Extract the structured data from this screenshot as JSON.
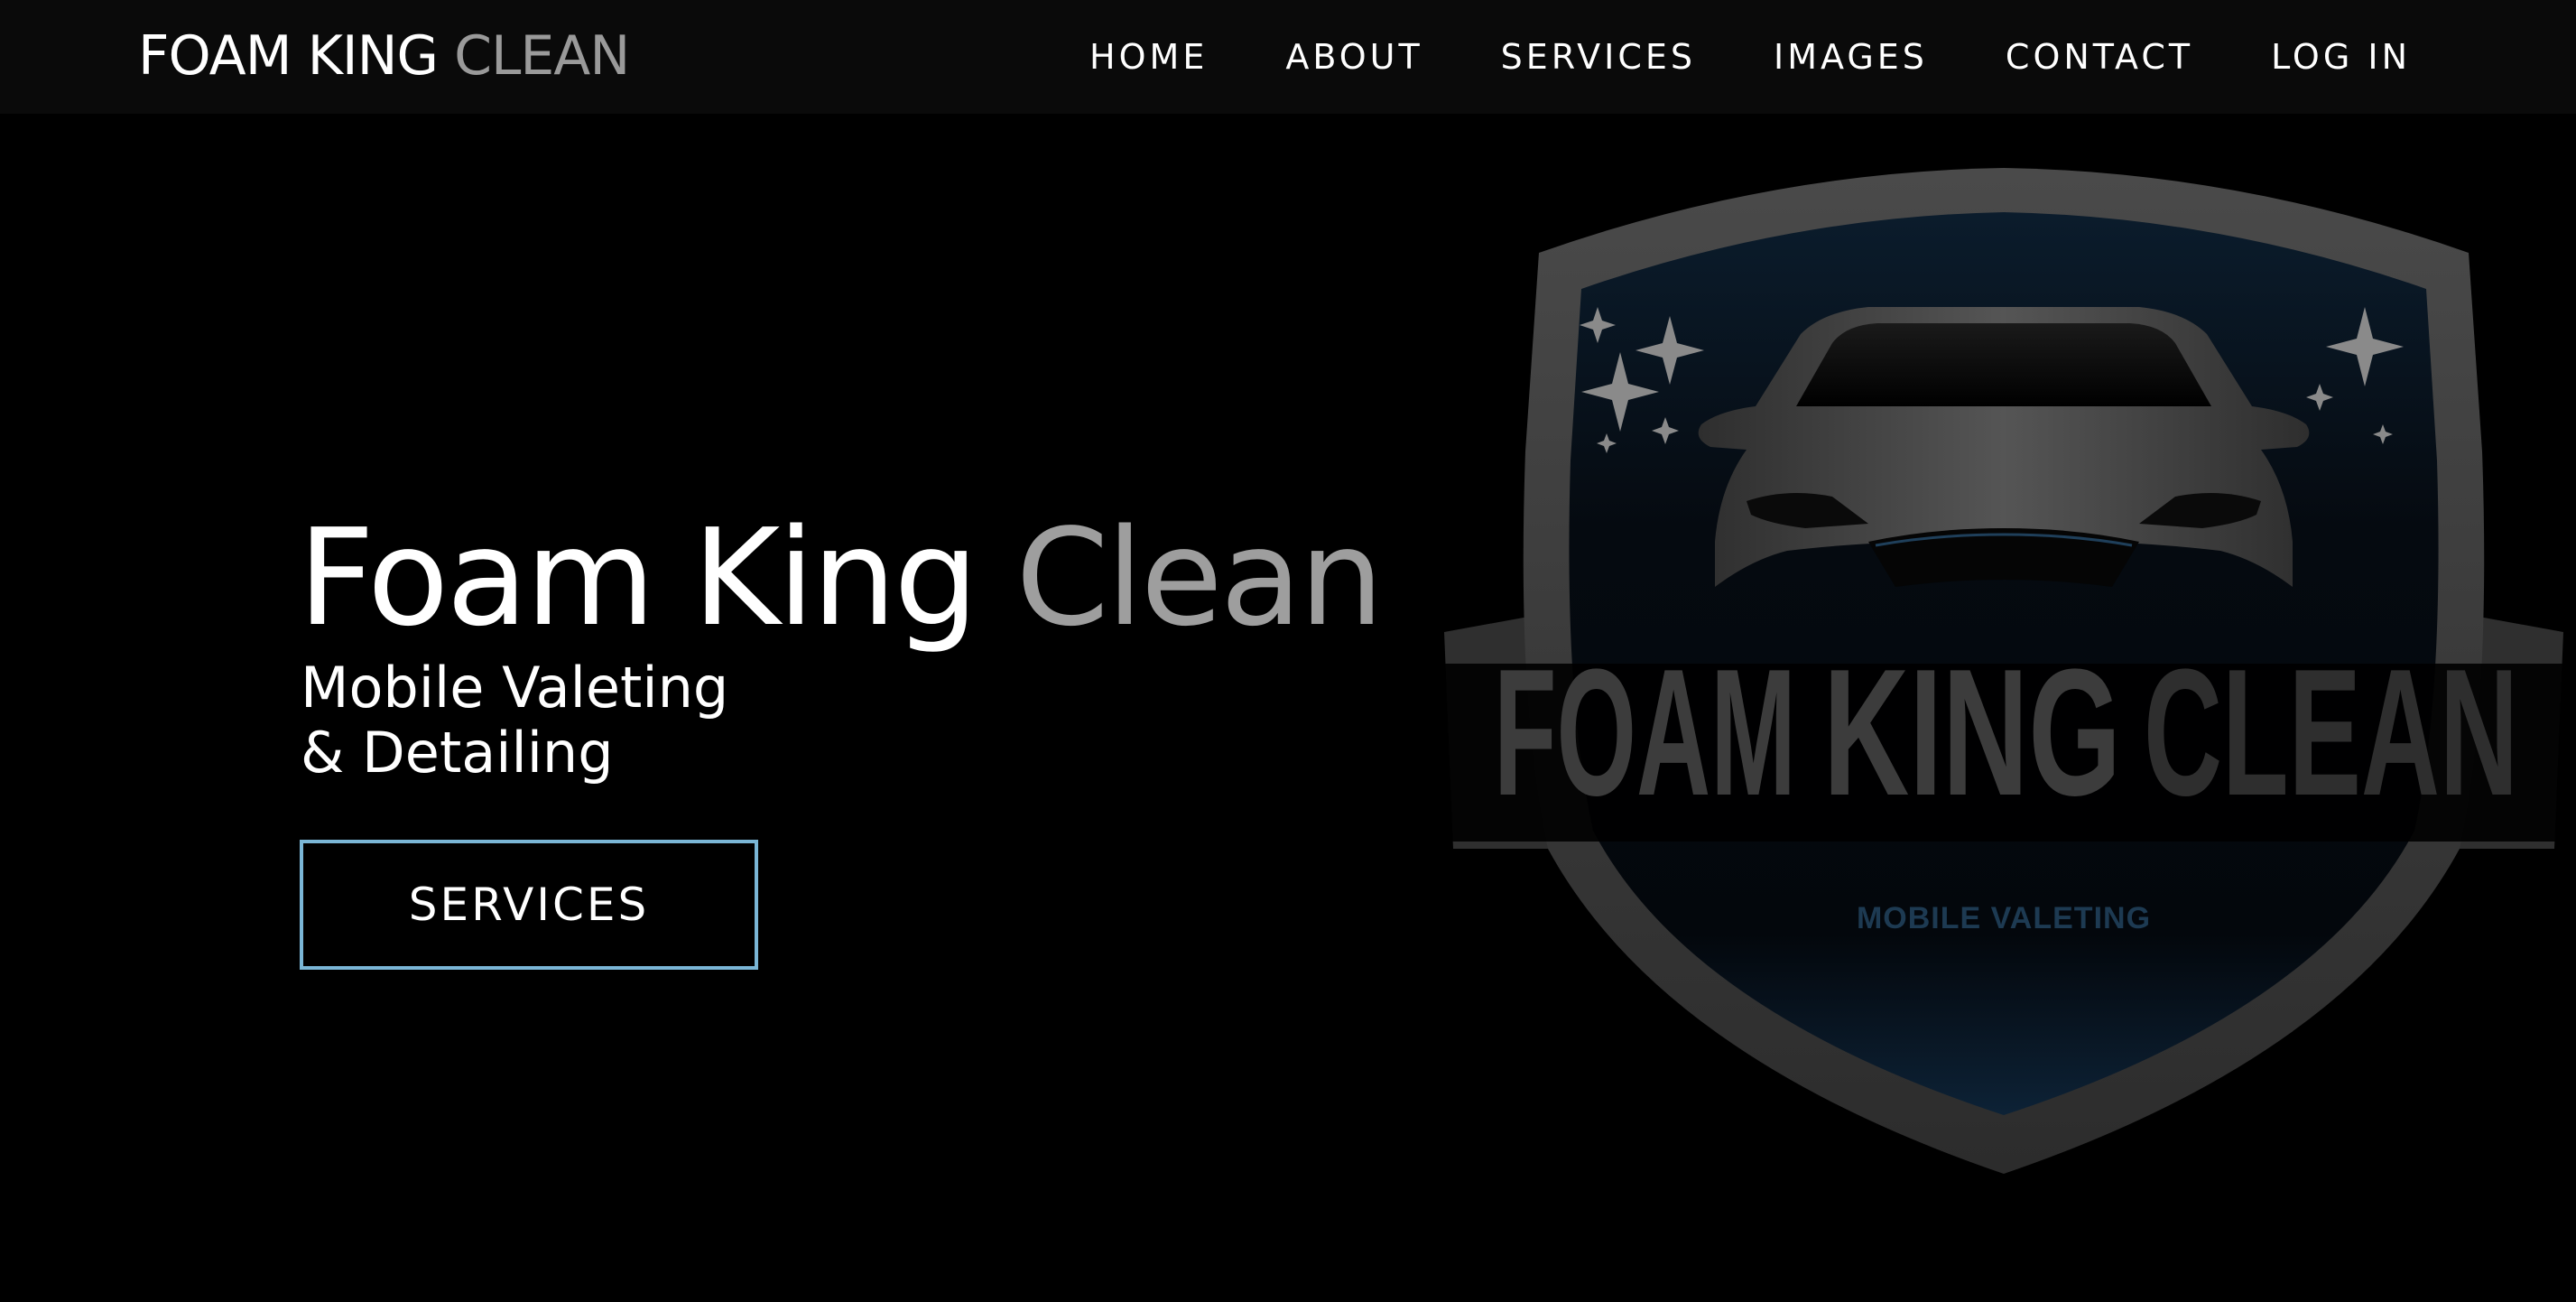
{
  "brand": {
    "part1": "FOAM KING",
    "part2": "CLEAN"
  },
  "nav": {
    "items": [
      {
        "label": "HOME"
      },
      {
        "label": "ABOUT"
      },
      {
        "label": "SERVICES"
      },
      {
        "label": "IMAGES"
      },
      {
        "label": "CONTACT"
      },
      {
        "label": "LOG IN"
      }
    ]
  },
  "hero": {
    "title_part1": "Foam King",
    "title_part2": "Clean",
    "subtitle_line1": "Mobile Valeting",
    "subtitle_line2": "& Detailing",
    "button_label": "SERVICES"
  },
  "logo": {
    "word1": "FOAM",
    "word2": "KING",
    "word3": "CLEAN",
    "tagline": "MOBILE VALETING"
  },
  "colors": {
    "background": "#000000",
    "navbar": "#0a0a0a",
    "accent_border": "#7ab6d6",
    "muted_text": "#9e9e9e"
  }
}
